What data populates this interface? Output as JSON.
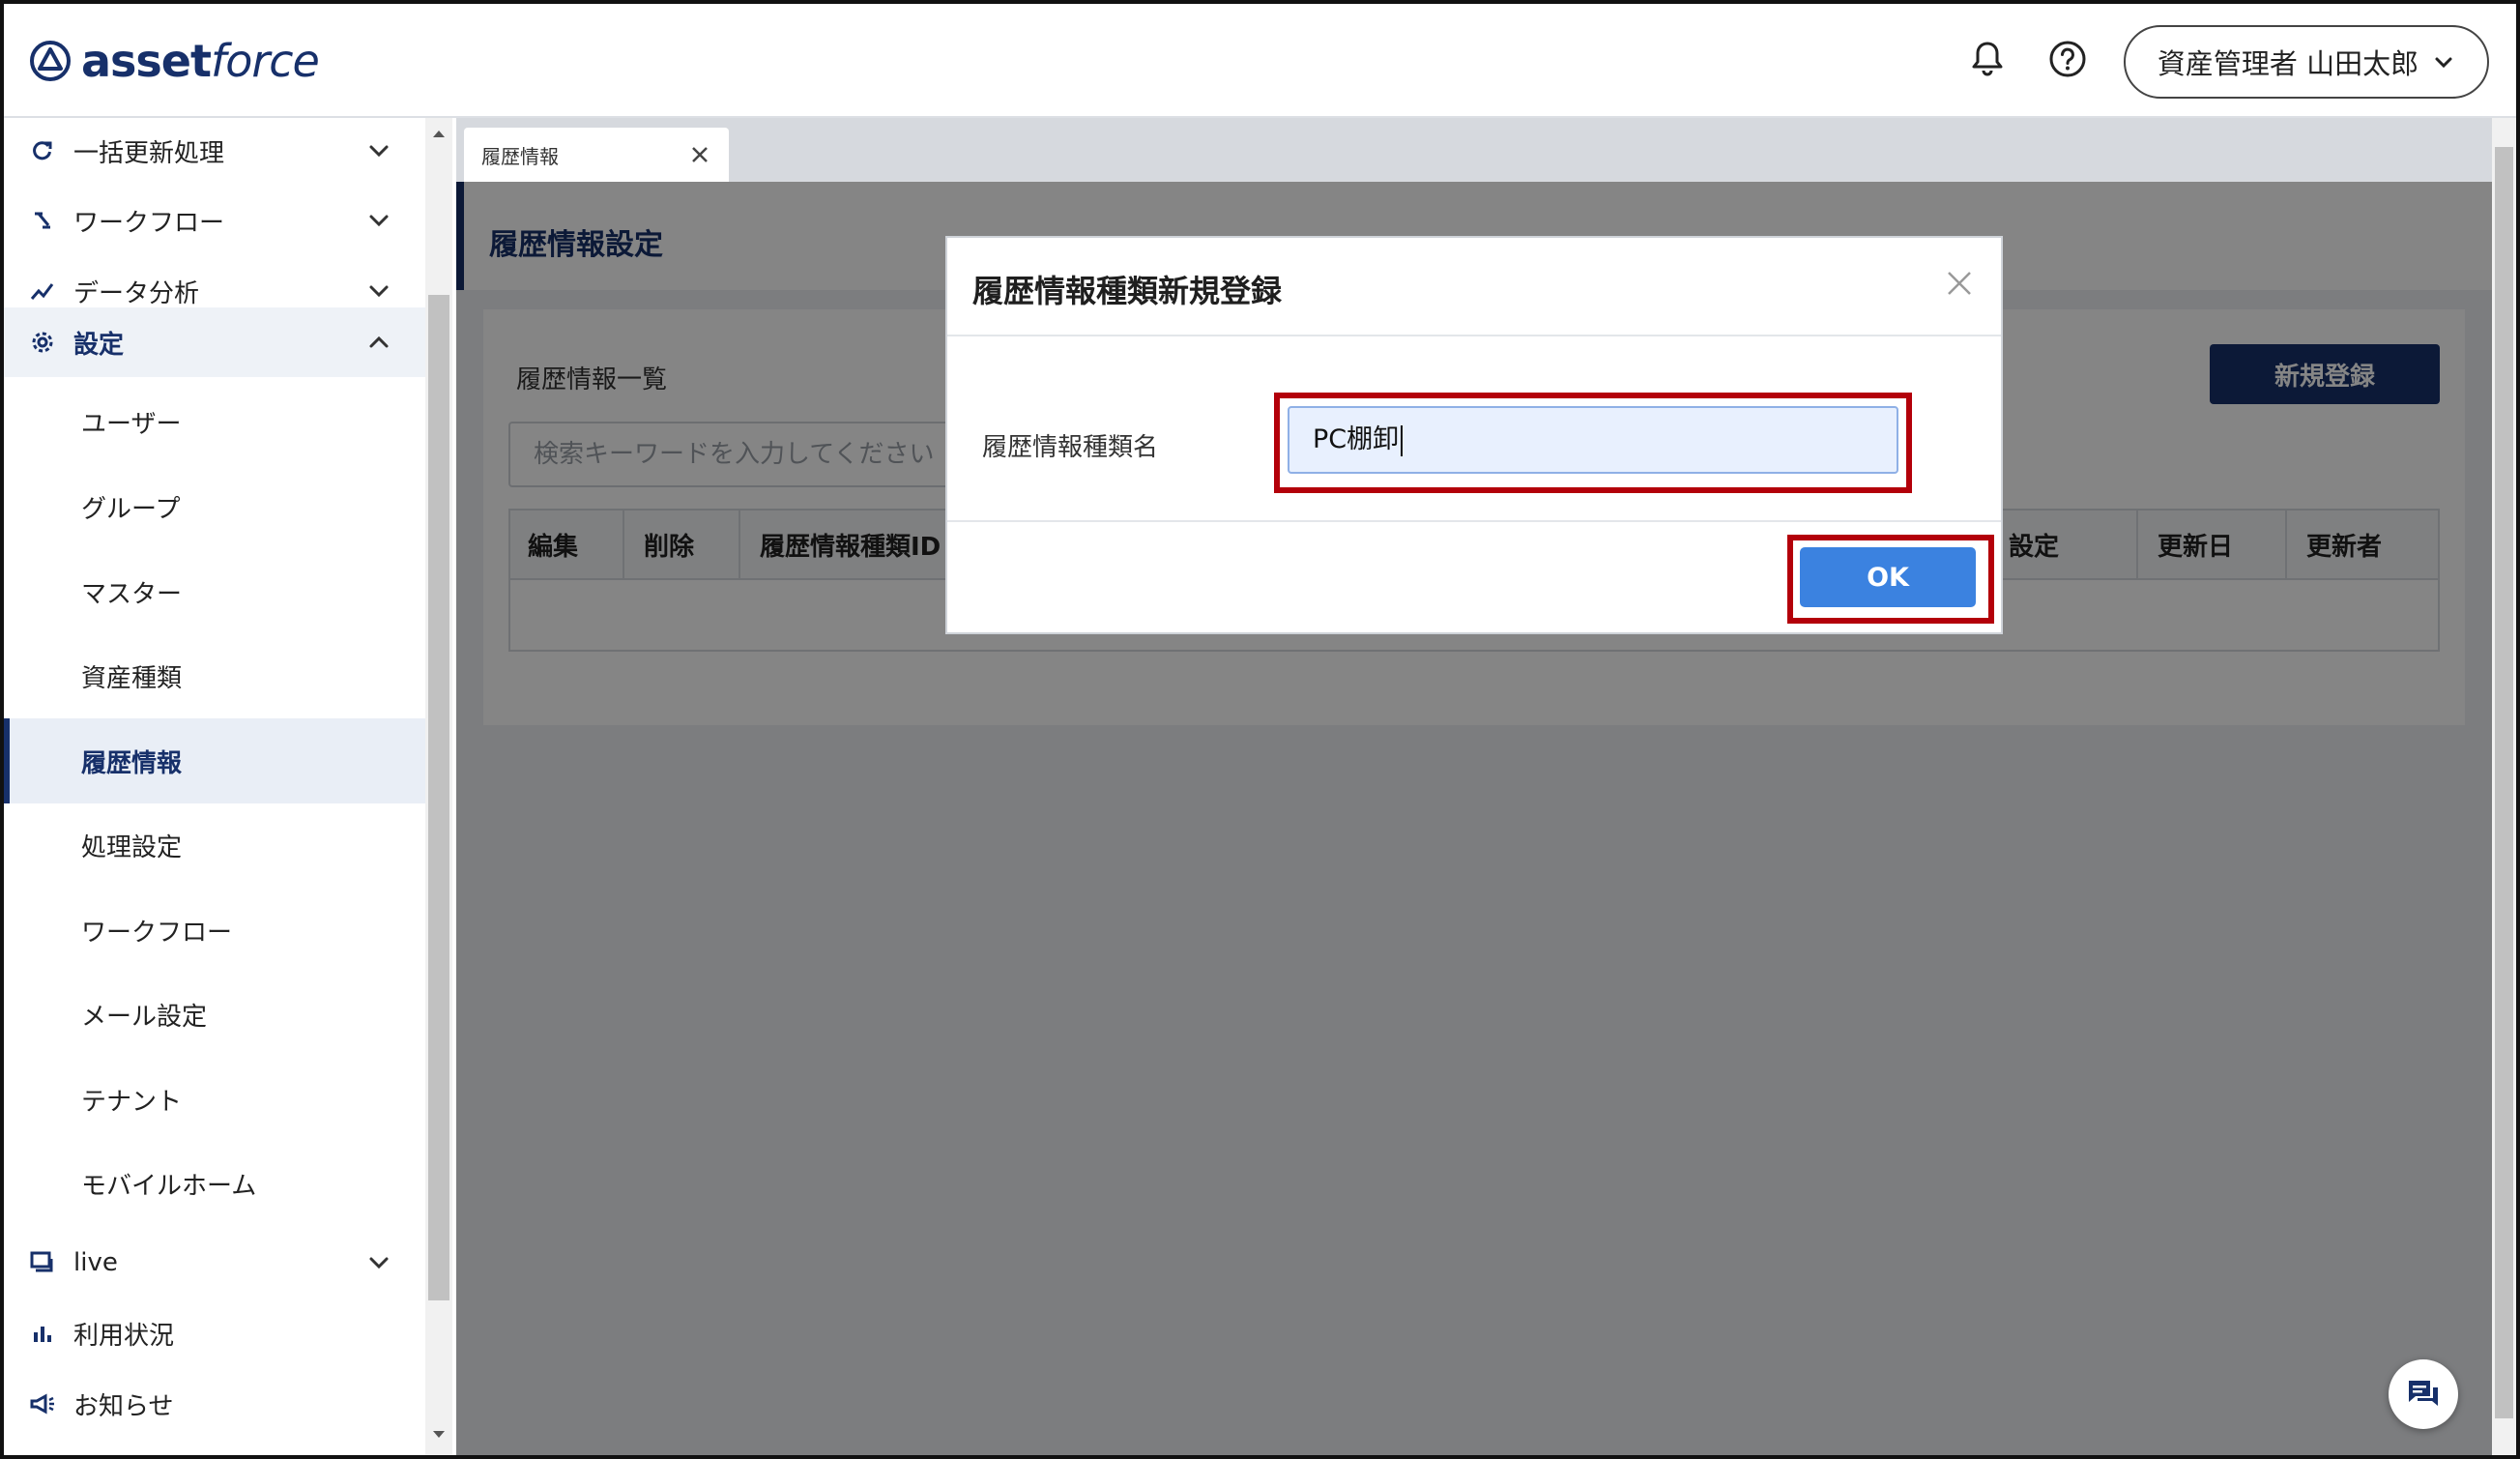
{
  "app": {
    "logo_text_bold": "asset",
    "logo_text_italic": "force"
  },
  "header": {
    "user_name": "資産管理者 山田太郎"
  },
  "sidebar": {
    "top_items": [
      {
        "label": "一括更新処理",
        "icon": "refresh-icon"
      },
      {
        "label": "ワークフロー",
        "icon": "workflow-icon"
      },
      {
        "label": "データ分析",
        "icon": "analytics-icon"
      },
      {
        "label": "設定",
        "icon": "gear-icon"
      }
    ],
    "settings_children": [
      "ユーザー",
      "グループ",
      "マスター",
      "資産種類",
      "履歴情報",
      "処理設定",
      "ワークフロー",
      "メール設定",
      "テナント",
      "モバイルホーム"
    ],
    "bottom_items": [
      {
        "label": "live",
        "icon": "chat-icon"
      },
      {
        "label": "利用状況",
        "icon": "bar-chart-icon"
      },
      {
        "label": "お知らせ",
        "icon": "megaphone-icon"
      }
    ]
  },
  "tabs": [
    {
      "label": "履歴情報"
    }
  ],
  "page": {
    "title": "履歴情報設定",
    "list_title": "履歴情報一覧",
    "new_button": "新規登録",
    "search_placeholder": "検索キーワードを入力してください",
    "columns": [
      "編集",
      "削除",
      "履歴情報種類ID",
      "設定",
      "更新日",
      "更新者"
    ]
  },
  "modal": {
    "title": "履歴情報種類新規登録",
    "field_label": "履歴情報種類名",
    "field_value": "PC棚卸",
    "ok_label": "OK"
  },
  "colors": {
    "brand": "#17306a",
    "ok": "#3b82e0",
    "highlight": "#b3000a"
  }
}
